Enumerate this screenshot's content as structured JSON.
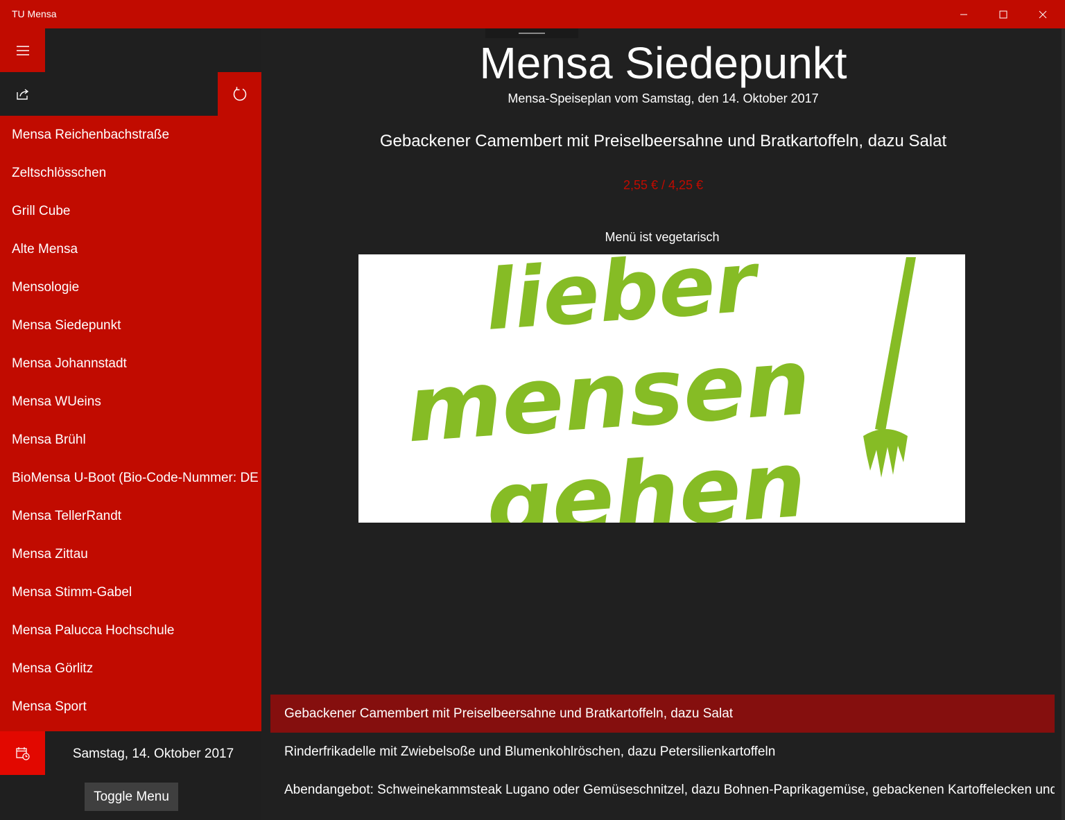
{
  "window": {
    "title": "TU Mensa"
  },
  "sidebar": {
    "mensas": [
      "Mensa Reichenbachstraße",
      "Zeltschlösschen",
      "Grill Cube",
      "Alte Mensa",
      "Mensologie",
      "Mensa Siedepunkt",
      "Mensa Johannstadt",
      "Mensa WUeins",
      "Mensa Brühl",
      "BioMensa U-Boot (Bio-Code-Nummer: DE",
      "Mensa TellerRandt",
      "Mensa Zittau",
      "Mensa Stimm-Gabel",
      "Mensa Palucca Hochschule",
      "Mensa Görlitz",
      "Mensa Sport"
    ],
    "date": "Samstag, 14. Oktober 2017",
    "toggle_label": "Toggle Menu"
  },
  "main": {
    "title": "Mensa Siedepunkt",
    "subtitle": "Mensa-Speiseplan vom Samstag, den 14. Oktober 2017",
    "dish_title": "Gebackener Camembert mit Preiselbeersahne  und Bratkartoffeln, dazu Salat",
    "price": "2,55 € / 4,25 €",
    "veg_label": "Menü ist vegetarisch",
    "logo_lines": [
      "lieber",
      "mensen",
      "gehen"
    ],
    "menu_items": [
      "Gebackener Camembert mit Preiselbeersahne  und Bratkartoffeln, dazu Salat",
      "Rinderfrikadelle mit Zwiebelsoße und Blumenkohlröschen, dazu Petersilienkartoffeln",
      "Abendangebot: Schweinekammsteak Lugano oder Gemüseschnitzel, dazu Bohnen-Paprikagemüse, gebackenen Kartoffelecken und K"
    ]
  },
  "colors": {
    "accent": "#c10b00",
    "selected": "#850f0e",
    "background": "#202020",
    "logo_green": "#86bc25"
  }
}
